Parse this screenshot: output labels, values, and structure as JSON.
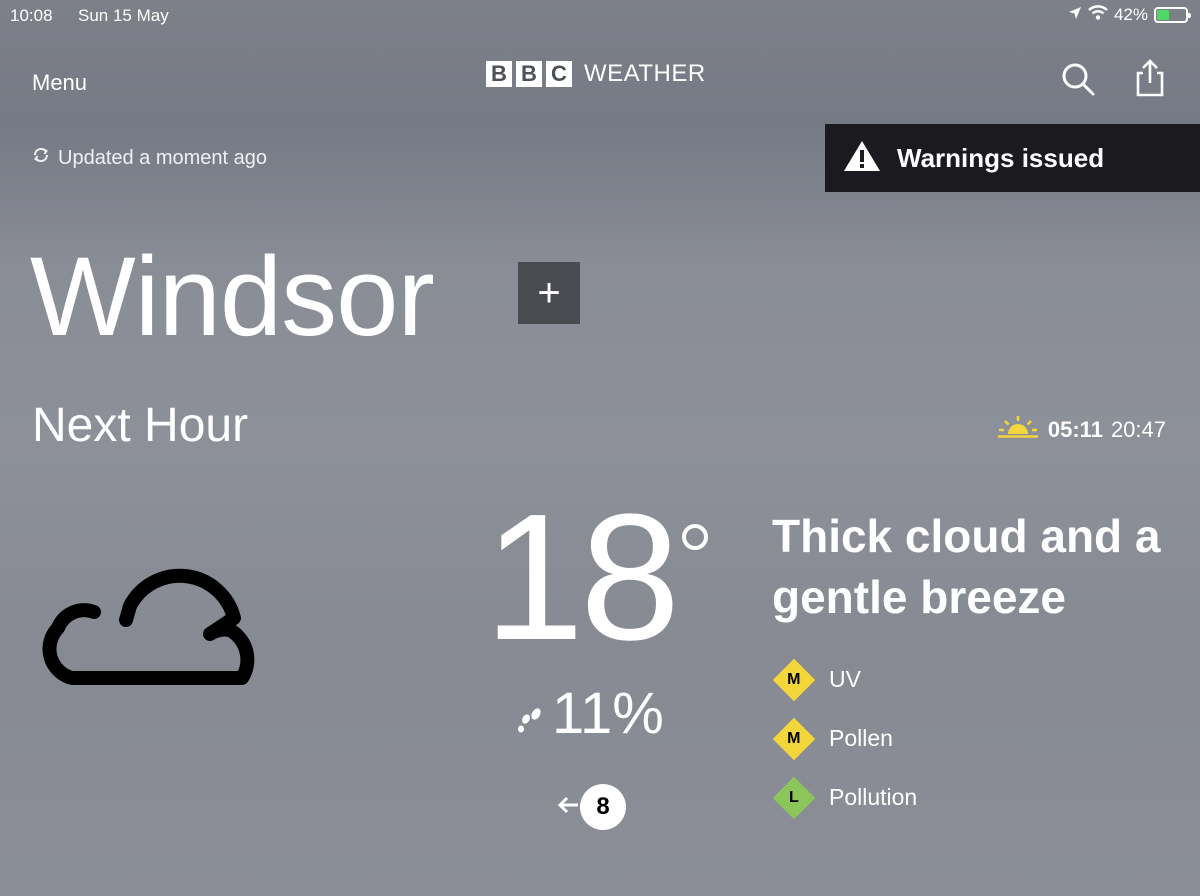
{
  "status_bar": {
    "time": "10:08",
    "date": "Sun 15 May",
    "battery": "42%",
    "battery_level": 0.42
  },
  "header": {
    "menu_label": "Menu",
    "logo_letters": [
      "B",
      "B",
      "C"
    ],
    "logo_text": "WEATHER"
  },
  "updated": "Updated a moment ago",
  "warning": {
    "label": "Warnings issued"
  },
  "location": {
    "name": "Windsor",
    "add_label": "+"
  },
  "forecast": {
    "period": "Next Hour",
    "sunrise": "05:11",
    "sunset": "20:47",
    "temperature": "18",
    "rain_chance": "11%",
    "hour": "8",
    "description": "Thick cloud and a gentle breeze"
  },
  "indices": [
    {
      "level": "M",
      "label": "UV",
      "color": "#f2d63a"
    },
    {
      "level": "M",
      "label": "Pollen",
      "color": "#f2d63a"
    },
    {
      "level": "L",
      "label": "Pollution",
      "color": "#8cc55a"
    }
  ],
  "colors": {
    "sun_icon": "#f2d63a",
    "warning_bg": "#1b1b1f"
  }
}
